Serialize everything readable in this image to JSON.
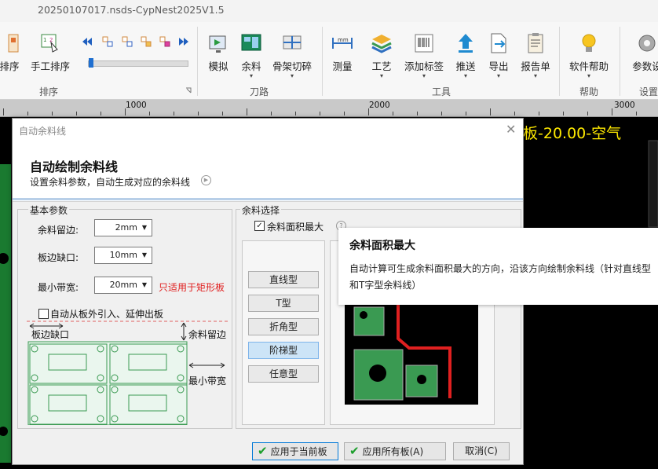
{
  "window": {
    "title": "20250107017.nsds-CypNest2025V1.5"
  },
  "ribbon": {
    "groups": [
      {
        "label": "排序"
      },
      {
        "label": "刀路"
      },
      {
        "label": "工具"
      },
      {
        "label": "帮助"
      },
      {
        "label": "设置"
      }
    ],
    "buttons": {
      "sort": "排序",
      "manual_sort": "手工排序",
      "simulate": "模拟",
      "remnant": "余料",
      "skeleton_cut": "骨架切碎",
      "measure": "测量",
      "process": "工艺",
      "add_label": "添加标签",
      "push": "推送",
      "export": "导出",
      "report": "报告单",
      "software_help": "软件帮助",
      "param_settings": "参数设"
    }
  },
  "ruler": {
    "marks": [
      "1000",
      "2000",
      "3000"
    ]
  },
  "canvas": {
    "overlay_text": "板-20.00-空气"
  },
  "dialog": {
    "title": "自动余料线",
    "heading": "自动绘制余料线",
    "subtitle": "设置余料参数，自动生成对应的余料线",
    "basic": {
      "legend": "基本参数",
      "margin_label": "余料留边:",
      "margin_value": "2mm",
      "notch_label": "板边缺口:",
      "notch_value": "10mm",
      "minwidth_label": "最小带宽:",
      "minwidth_value": "20mm",
      "minwidth_note": "只适用于矩形板",
      "auto_lead_label": "自动从板外引入、延伸出板",
      "auto_lead_checked": false,
      "diagram": {
        "notch": "板边缺口",
        "margin": "余料留边",
        "minwidth": "最小带宽"
      }
    },
    "selection": {
      "legend": "余料选择",
      "max_area_label": "余料面积最大",
      "max_area_checked": true,
      "options": [
        "直线型",
        "T型",
        "折角型",
        "阶梯型",
        "任意型"
      ],
      "selected": "阶梯型"
    },
    "buttons": {
      "apply_current": "应用于当前板",
      "apply_all": "应用所有板(A)",
      "cancel": "取消(C)"
    }
  },
  "tooltip": {
    "title": "余料面积最大",
    "body": "自动计算可生成余料面积最大的方向，沿该方向绘制余料线（针对直线型和T字型余料线）"
  },
  "colors": {
    "accent": "#0078d7",
    "note_red": "#e02020",
    "canvas_bg": "#000000",
    "overlay_yellow": "#ffea00",
    "part_green": "#3a9a52"
  }
}
